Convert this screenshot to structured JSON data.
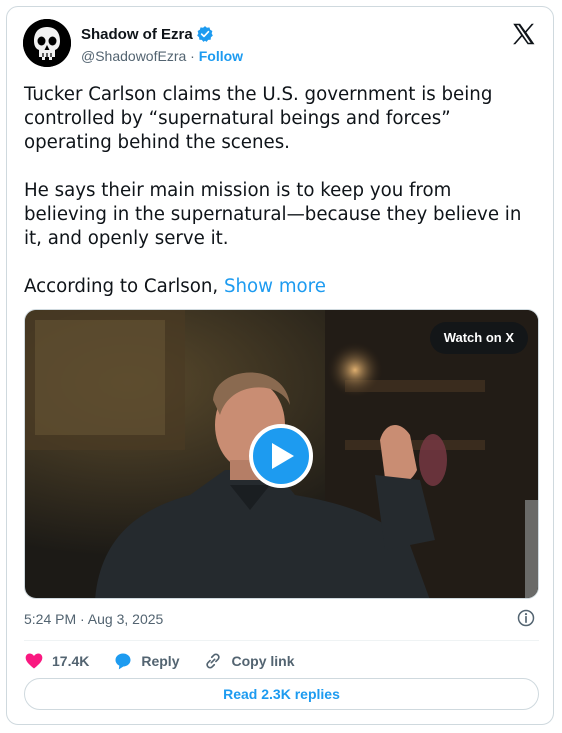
{
  "author": {
    "display_name": "Shadow of Ezra",
    "handle": "@ShadowofEzra",
    "separator": " · ",
    "follow_label": "Follow",
    "verified": true
  },
  "tweet": {
    "paragraphs": [
      "Tucker Carlson claims the U.S. government is being controlled by “supernatural beings and forces” operating behind the scenes.",
      "He says their main mission is to keep you from believing in the supernatural—because they believe in it, and openly serve it."
    ],
    "truncated_text": "According to Carlson, ",
    "show_more_label": "Show more"
  },
  "media": {
    "watch_label": "Watch on X"
  },
  "timestamp": "5:24 PM · Aug 3, 2025",
  "actions": {
    "likes": "17.4K",
    "reply_label": "Reply",
    "copy_link_label": "Copy link"
  },
  "replies_button": "Read 2.3K replies",
  "colors": {
    "accent": "#1d9bf0",
    "like": "#f91880",
    "text": "#0f1419",
    "muted": "#536471",
    "border": "#cfd9de"
  },
  "icons": [
    "verified-badge-icon",
    "x-logo-icon",
    "play-icon",
    "info-icon",
    "heart-icon",
    "reply-bubble-icon",
    "link-icon"
  ]
}
